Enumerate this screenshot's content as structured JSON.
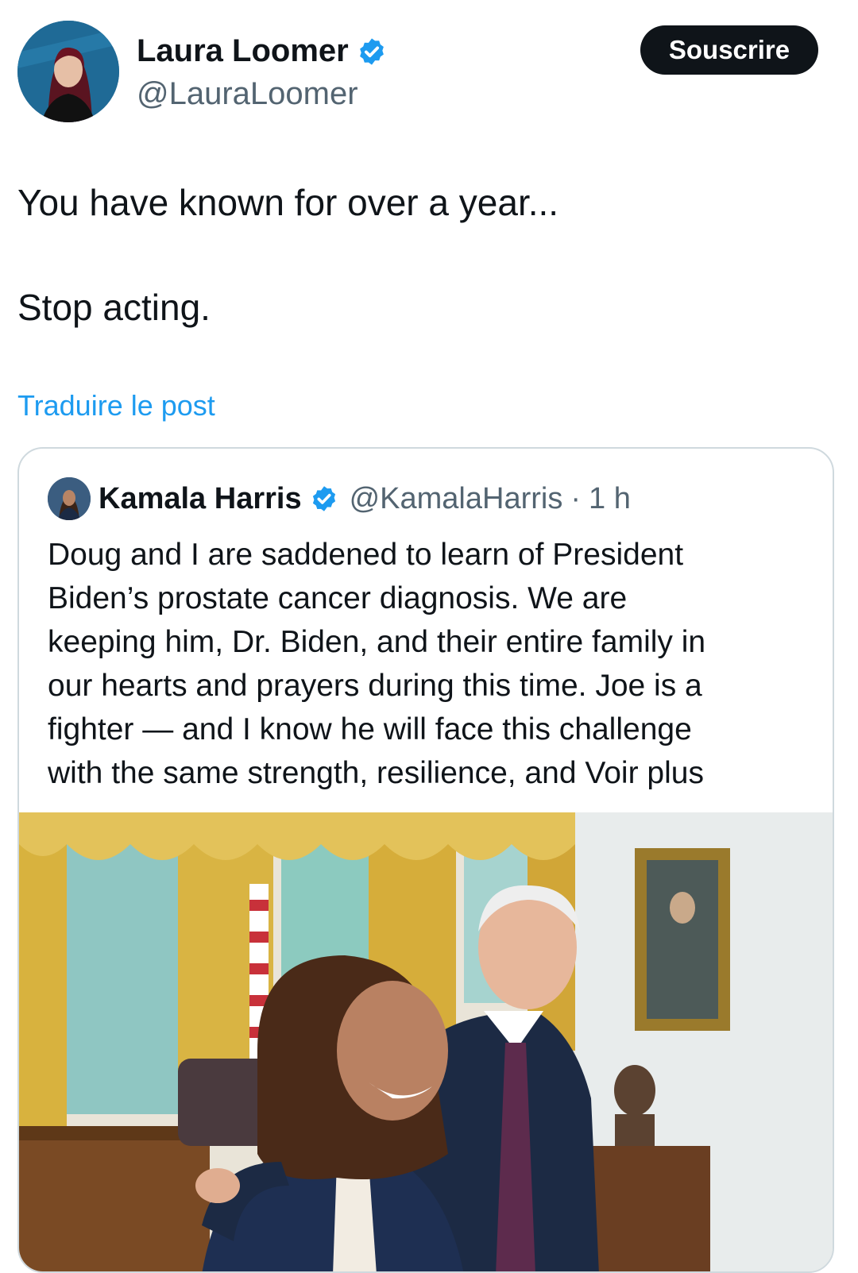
{
  "author": {
    "display_name": "Laura Loomer",
    "handle": "@LauraLoomer",
    "verified": true
  },
  "subscribe_label": "Souscrire",
  "tweet": {
    "lines": [
      "You have known for over a year...",
      "Stop acting."
    ]
  },
  "translate_label": "Traduire le post",
  "quote": {
    "display_name": "Kamala Harris",
    "handle": "@KamalaHarris",
    "separator": "·",
    "time": "1 h",
    "lines": [
      "Doug and I are saddened to learn of President",
      "Biden’s prostate cancer diagnosis. We are",
      "keeping him, Dr. Biden, and their entire family in",
      "our hearts and prayers during this time. Joe is a",
      "fighter — and I know he will face this challenge",
      "with the same strength, resilience, and "
    ],
    "see_more": "Voir plus"
  },
  "colors": {
    "link_blue": "#1d9bf0",
    "text_primary": "#0f1419",
    "text_secondary": "#536471",
    "verified_blue": "#1d9bf0",
    "button_bg": "#0f1419"
  },
  "icons": [
    "verified-badge-icon",
    "avatar-laura-loomer",
    "avatar-kamala-harris"
  ]
}
